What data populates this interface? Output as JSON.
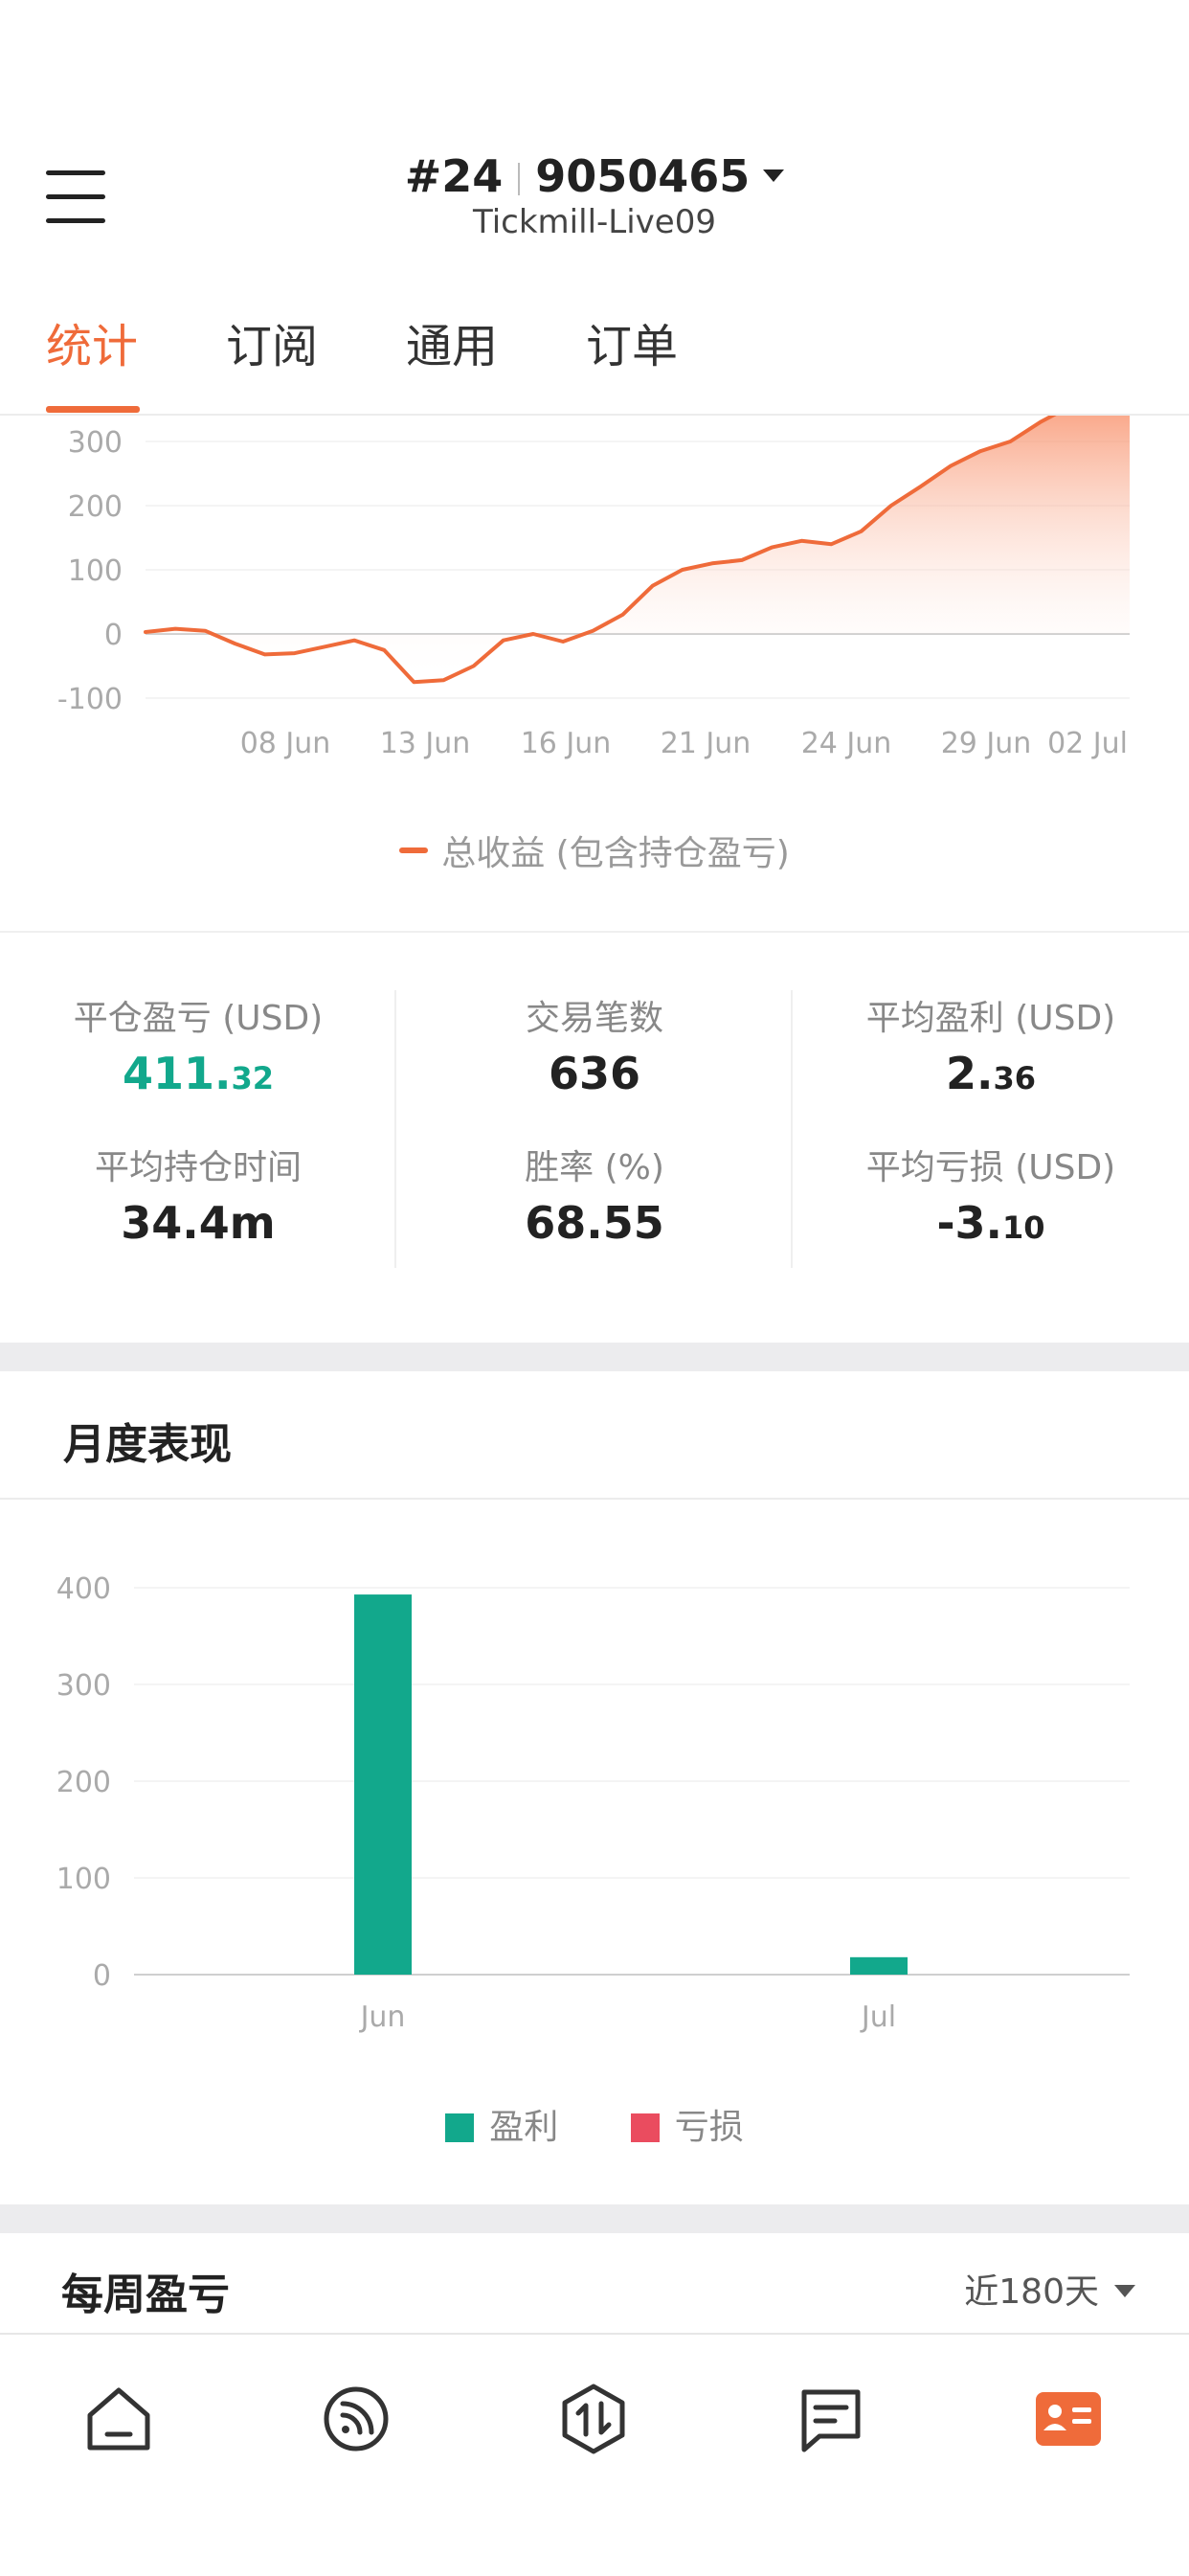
{
  "header": {
    "rank": "#24",
    "account_id": "9050465",
    "server": "Tickmill-Live09"
  },
  "tabs": [
    {
      "label": "统计",
      "active": true
    },
    {
      "label": "订阅",
      "active": false
    },
    {
      "label": "通用",
      "active": false
    },
    {
      "label": "订单",
      "active": false
    }
  ],
  "colors": {
    "accent": "#ef6b3a",
    "profit": "#12a88c",
    "loss": "#ea4c5f"
  },
  "chart_data": [
    {
      "type": "area",
      "series": [
        {
          "name": "总收益 (包含持仓盈亏)",
          "points": [
            [
              0,
              3
            ],
            [
              1,
              8
            ],
            [
              2,
              5
            ],
            [
              3,
              -15
            ],
            [
              4,
              -32
            ],
            [
              5,
              -30
            ],
            [
              6,
              -20
            ],
            [
              7,
              -10
            ],
            [
              8,
              -25
            ],
            [
              9,
              -75
            ],
            [
              10,
              -72
            ],
            [
              11,
              -50
            ],
            [
              12,
              -10
            ],
            [
              13,
              0
            ],
            [
              14,
              -12
            ],
            [
              15,
              5
            ],
            [
              16,
              30
            ],
            [
              17,
              75
            ],
            [
              18,
              100
            ],
            [
              19,
              110
            ],
            [
              20,
              115
            ],
            [
              21,
              135
            ],
            [
              22,
              145
            ],
            [
              23,
              140
            ],
            [
              24,
              160
            ],
            [
              25,
              200
            ],
            [
              26,
              230
            ],
            [
              27,
              262
            ],
            [
              28,
              285
            ],
            [
              29,
              300
            ],
            [
              30,
              330
            ],
            [
              31,
              355
            ],
            [
              32,
              375
            ],
            [
              33,
              380
            ]
          ]
        }
      ],
      "x_tick_labels": [
        "08 Jun",
        "13 Jun",
        "16 Jun",
        "21 Jun",
        "24 Jun",
        "29 Jun",
        "02 Jul"
      ],
      "y_ticks": [
        300,
        200,
        100,
        0,
        -100
      ],
      "ylim": [
        -100,
        340
      ],
      "legend": "总收益 (包含持仓盈亏)"
    },
    {
      "type": "bar",
      "categories": [
        "Jun",
        "Jul"
      ],
      "series": [
        {
          "name": "盈利",
          "values": [
            393,
            18
          ]
        },
        {
          "name": "亏损",
          "values": [
            0,
            0
          ]
        }
      ],
      "y_ticks": [
        400,
        300,
        200,
        100,
        0
      ],
      "ylim": [
        0,
        400
      ]
    }
  ],
  "stats": {
    "closed_pnl": {
      "label": "平仓盈亏 (USD)",
      "int": "411.",
      "dec": "32"
    },
    "trade_count": {
      "label": "交易笔数",
      "value": "636"
    },
    "avg_profit": {
      "label": "平均盈利 (USD)",
      "int": "2.",
      "dec": "36"
    },
    "avg_hold": {
      "label": "平均持仓时间",
      "value": "34.4m"
    },
    "win_rate": {
      "label": "胜率 (%)",
      "value": "68.55"
    },
    "avg_loss": {
      "label": "平均亏损 (USD)",
      "int": "-3.",
      "dec": "10"
    }
  },
  "monthly": {
    "title": "月度表现",
    "legend_profit": "盈利",
    "legend_loss": "亏损"
  },
  "weekly": {
    "title": "每周盈亏",
    "range": "近180天"
  },
  "bottom_nav": [
    {
      "icon": "home-icon"
    },
    {
      "icon": "feed-icon"
    },
    {
      "icon": "trade-icon"
    },
    {
      "icon": "message-icon"
    },
    {
      "icon": "profile-card-icon",
      "active": true
    }
  ]
}
